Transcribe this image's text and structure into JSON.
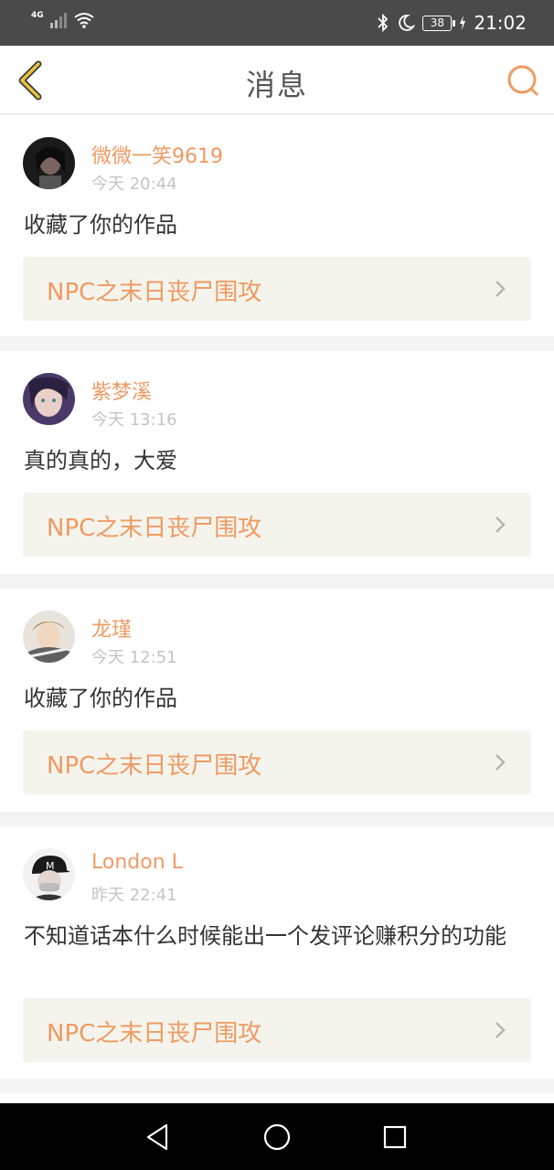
{
  "status_bar": {
    "network": "4G",
    "battery": "38",
    "time": "21:02"
  },
  "header": {
    "title": "消息"
  },
  "messages": [
    {
      "username": "微微一笑9619",
      "time": "今天 20:44",
      "content": "收藏了你的作品",
      "work": "NPC之末日丧尸围攻"
    },
    {
      "username": "紫梦溪",
      "time": "今天 13:16",
      "content": "真的真的，大爱",
      "work": "NPC之末日丧尸围攻"
    },
    {
      "username": "龙瑾",
      "time": "今天 12:51",
      "content": "收藏了你的作品",
      "work": "NPC之末日丧尸围攻"
    },
    {
      "username": "London L",
      "time": "昨天 22:41",
      "content": "不知道话本什么时候能出一个发评论赚积分的功能",
      "work": "NPC之末日丧尸围攻"
    }
  ],
  "colors": {
    "accent": "#ef9a63",
    "back_icon": "#e8c040",
    "link_bg": "#f4f4ec"
  }
}
